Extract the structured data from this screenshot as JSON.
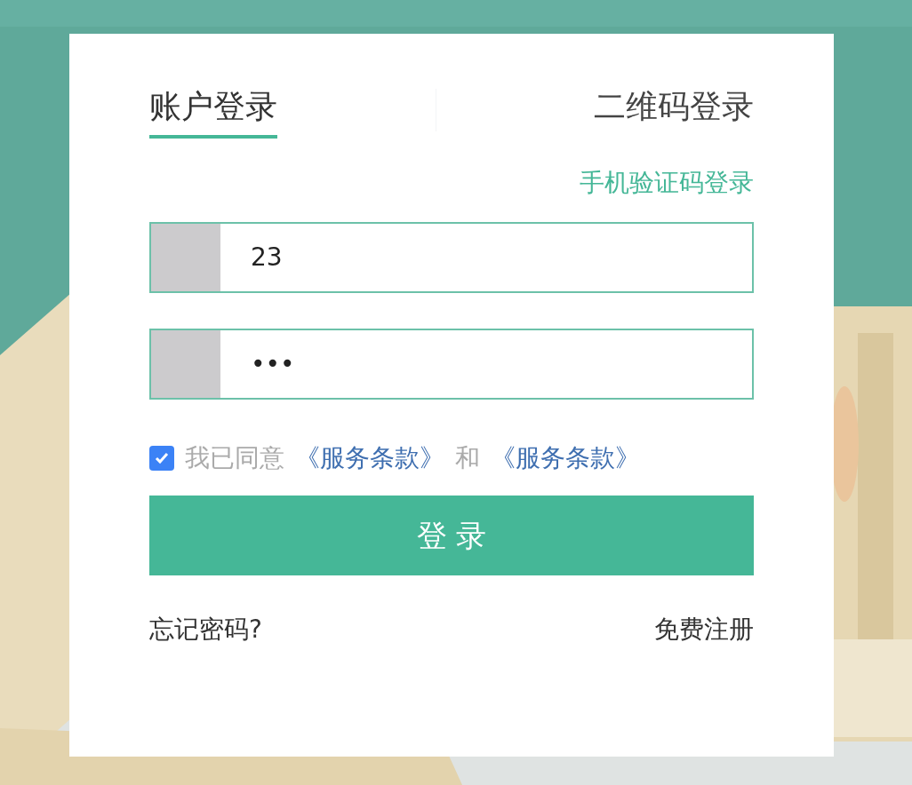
{
  "tabs": [
    {
      "label": "账户登录",
      "selected": true
    },
    {
      "label": "二维码登录",
      "selected": false
    }
  ],
  "alt_login_link": "手机验证码登录",
  "fields": [
    {
      "value": "23"
    },
    {
      "value": "•••"
    }
  ],
  "agreement": {
    "checked": true,
    "parts": [
      {
        "kind": "plain",
        "text": "我已同意"
      },
      {
        "kind": "link",
        "text": "《服务条款》"
      },
      {
        "kind": "plain",
        "text": "和"
      },
      {
        "kind": "link",
        "text": "《服务条款》"
      }
    ]
  },
  "submit_button": "登 录",
  "footer_links": [
    "忘记密码?",
    "免费注册"
  ]
}
